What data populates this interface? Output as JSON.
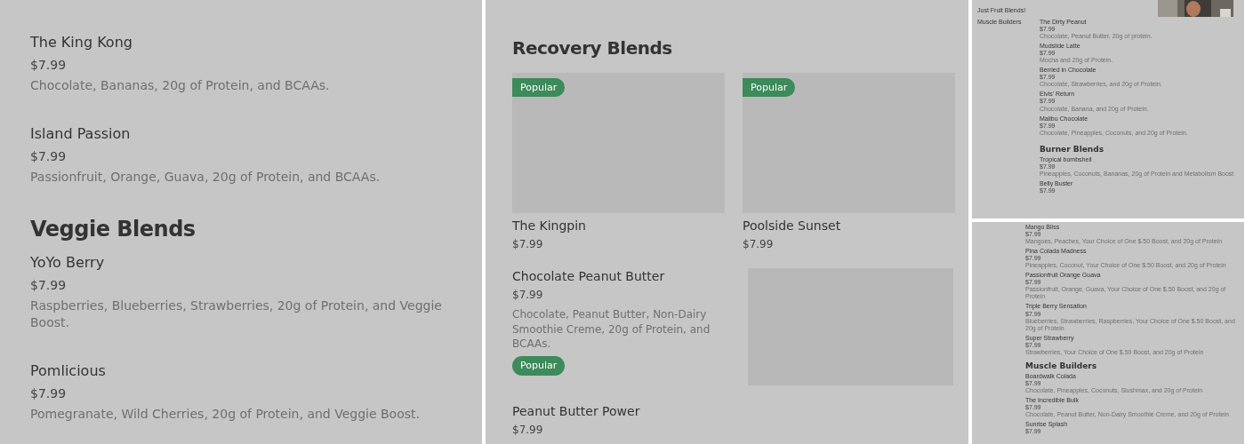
{
  "left_panel": {
    "sections": [
      {
        "items": [
          {
            "name": "The King Kong",
            "price": "$7.99",
            "description": "Chocolate, Bananas, 20g of Protein, and BCAAs."
          },
          {
            "name": "Island Passion",
            "price": "$7.99",
            "description": "Passionfruit, Orange, Guava, 20g of Protein, and BCAAs."
          }
        ]
      },
      {
        "heading": "Veggie Blends",
        "items": [
          {
            "name": "YoYo Berry",
            "price": "$7.99",
            "description": "Raspberries, Blueberries, Strawberries, 20g of Protein, and Veggie Boost."
          },
          {
            "name": "Pomlicious",
            "price": "$7.99",
            "description": "Pomegranate, Wild Cherries, 20g of Protein, and Veggie Boost."
          }
        ]
      }
    ]
  },
  "center_panel": {
    "heading": "Recovery Blends",
    "cards": [
      {
        "name": "The Kingpin",
        "price": "$7.99",
        "badge": "Popular"
      },
      {
        "name": "Poolside Sunset",
        "price": "$7.99",
        "badge": "Popular"
      }
    ],
    "items": [
      {
        "name": "Chocolate Peanut Butter",
        "price": "$7.99",
        "description": "Chocolate, Peanut Butter, Non-Dairy Smoothie Creme, 20g of Protein, and BCAAs.",
        "badge": "Popular",
        "image": true
      },
      {
        "name": "Peanut Butter Power",
        "price": "$7.99",
        "image": false
      }
    ]
  },
  "right_top_panel": {
    "sidebar": [
      "Just Fruit Blends!",
      "Muscle Builders"
    ],
    "photo": {
      "kind": "picture"
    },
    "sections": [
      {
        "items": [
          {
            "name": "The Dirty Peanut",
            "price": "$7.99",
            "description": "Chocolate, Peanut Butter, 20g of protein."
          },
          {
            "name": "Mudslide Latte",
            "price": "$7.99",
            "description": "Mocha and 20g of Protein."
          },
          {
            "name": "Berried in Chocolate",
            "price": "$7.99",
            "description": "Chocolate, Strawberries, and 20g of Protein."
          },
          {
            "name": "Elvis' Return",
            "price": "$7.99",
            "description": "Chocolate, Banana, and 20g of Protein."
          },
          {
            "name": "Malibu Chocolate",
            "price": "$7.99",
            "description": "Chocolate, Pineapples, Coconuts, and 20g of Protein."
          }
        ]
      },
      {
        "heading": "Burner Blends",
        "items": [
          {
            "name": "Tropical bombshell",
            "price": "$7.99",
            "description": "Pineapples, Coconuts, Bananas, 20g of Protein and Metabolism Boost"
          },
          {
            "name": "Belly Buster",
            "price": "$7.99"
          }
        ]
      }
    ]
  },
  "right_bottom_panel": {
    "sections": [
      {
        "items": [
          {
            "name": "Mango Bliss",
            "price": "$7.99",
            "description": "Mangoes, Peaches, Your Choice of One $.50 Boost, and 20g of Protein"
          },
          {
            "name": "Pina Colada Madness",
            "price": "$7.99",
            "description": "Pineapples, Coconut, Your Choice of One $.50 Boost, and 20g of Protein"
          },
          {
            "name": "Passionfruit Orange Guava",
            "price": "$7.99",
            "description": "Passionfruit, Orange, Guava, Your Choice of One $.50 Boost, and 20g of Protein"
          },
          {
            "name": "Triple Berry Sensation",
            "price": "$7.99",
            "description": "Blueberries, Strawberries, Raspberries, Your Choice of One $.50 Boost, and 20g of Protein"
          },
          {
            "name": "Super Strawberry",
            "price": "$7.99",
            "description": "Strawberries, Your Choice of One $.50 Boost, and 20g of Protein"
          }
        ]
      },
      {
        "heading": "Muscle Builders",
        "items": [
          {
            "name": "Boardwalk Colada",
            "price": "$7.99",
            "description": "Chocolate, Pineapples, Coconuts, Slushmax, and 20g of Protein"
          },
          {
            "name": "The Incredible Bulk",
            "price": "$7.99",
            "description": "Chocolate, Peanut Butter, Non-Dairy Smoothie Creme, and 20g of Protein"
          },
          {
            "name": "Sunrise Splash",
            "price": "$7.99"
          }
        ]
      }
    ]
  }
}
